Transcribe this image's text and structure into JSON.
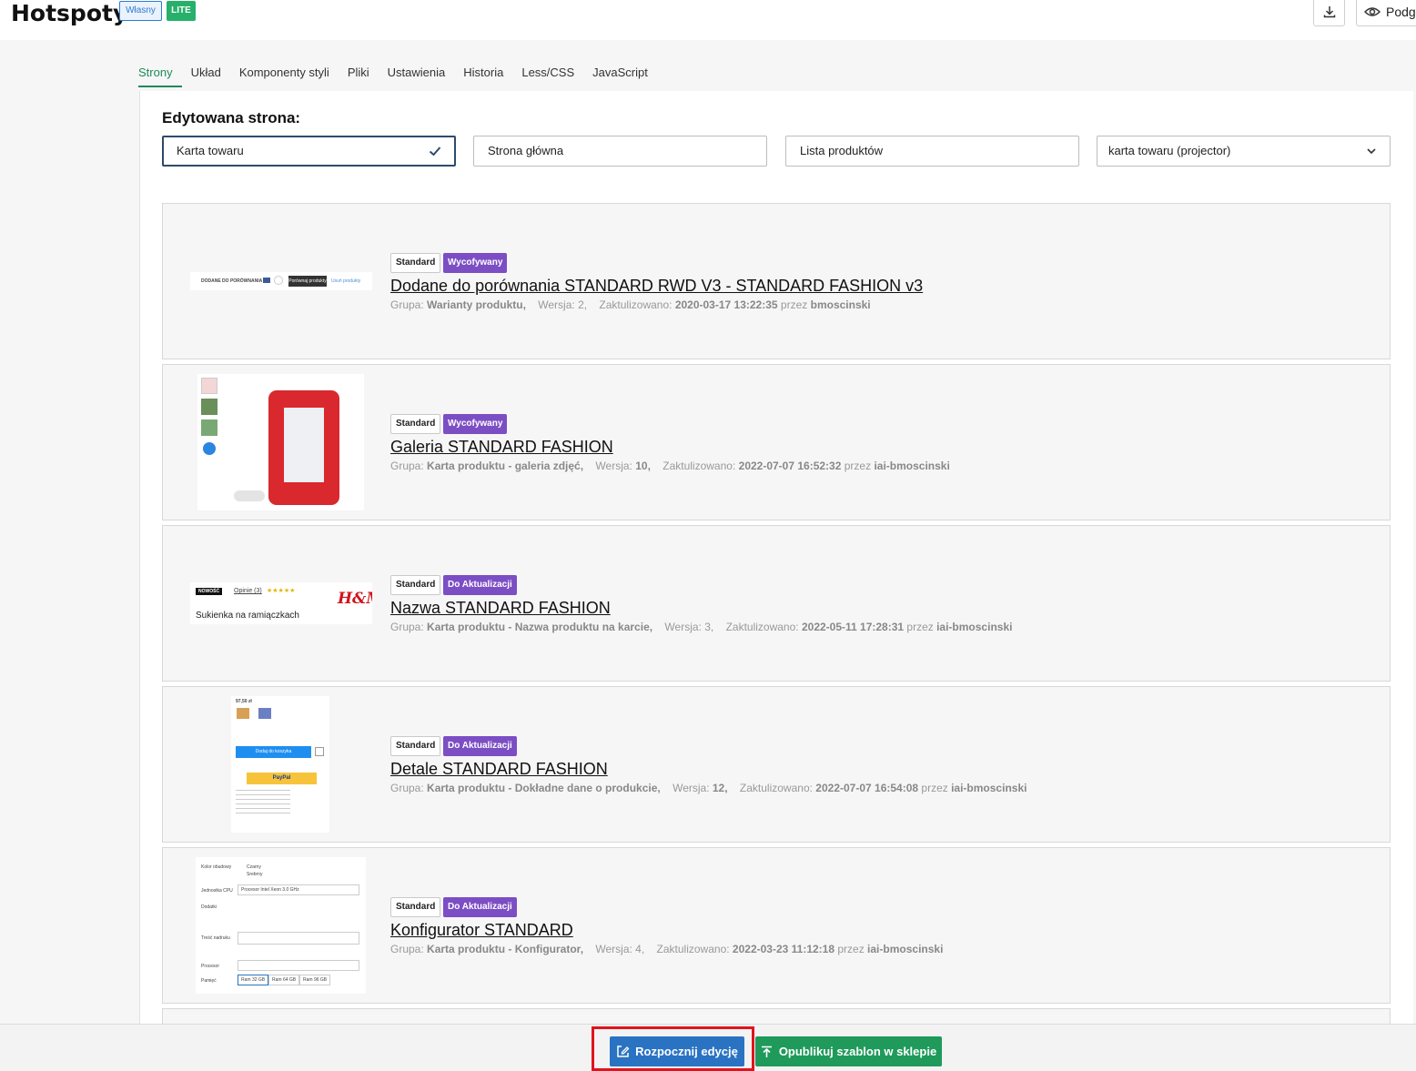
{
  "header": {
    "title": "Hotspoty",
    "badge_own": "Własny",
    "badge_lite": "LITE",
    "preview_label": "Podgląd"
  },
  "tabs": [
    {
      "label": "Strony",
      "active": true
    },
    {
      "label": "Układ"
    },
    {
      "label": "Komponenty styli"
    },
    {
      "label": "Pliki"
    },
    {
      "label": "Ustawienia"
    },
    {
      "label": "Historia"
    },
    {
      "label": "Less/CSS"
    },
    {
      "label": "JavaScript"
    }
  ],
  "editor": {
    "label": "Edytowana strona:",
    "pages": [
      {
        "label": "Karta towaru",
        "selected": true
      },
      {
        "label": "Strona główna"
      },
      {
        "label": "Lista produktów"
      },
      {
        "label": "karta towaru (projector)",
        "dropdown": true
      }
    ]
  },
  "components": [
    {
      "tags": [
        "Standard",
        "Wycofywany"
      ],
      "title": "Dodane do porównania STANDARD RWD V3 - STANDARD FASHION v3",
      "group_label": "Grupa:",
      "group": "Warianty produktu,",
      "version_label": "Wersja:",
      "version": "2,",
      "updated_label": "Zaktulizowano:",
      "updated": "2020-03-17 13:22:35",
      "by_label": "przez",
      "by": "bmoscinski",
      "thumb_text": [
        "DODANE DO PORÓWNANIA",
        "Porównaj produkty",
        "Usuń produkty"
      ]
    },
    {
      "tags": [
        "Standard",
        "Wycofywany"
      ],
      "title": "Galeria STANDARD FASHION",
      "group_label": "Grupa:",
      "group": "Karta produktu - galeria zdjęć,",
      "version_label": "Wersja:",
      "version": "10,",
      "updated_label": "Zaktulizowano:",
      "updated": "2022-07-07 16:52:32",
      "by_label": "przez",
      "by": "iai-bmoscinski"
    },
    {
      "tags": [
        "Standard",
        "Do Aktualizacji"
      ],
      "title": "Nazwa STANDARD FASHION",
      "group_label": "Grupa:",
      "group": "Karta produktu - Nazwa produktu na karcie,",
      "version_label": "Wersja:",
      "version": "3,",
      "updated_label": "Zaktulizowano:",
      "updated": "2022-05-11 17:28:31",
      "by_label": "przez",
      "by": "iai-bmoscinski",
      "thumb_text": [
        "NOWOŚĆ",
        "Opinie (3)",
        "★★★★★",
        "H&M",
        "Sukienka na ramiączkach"
      ]
    },
    {
      "tags": [
        "Standard",
        "Do Aktualizacji"
      ],
      "title": "Detale STANDARD FASHION",
      "group_label": "Grupa:",
      "group": "Karta produktu - Dokładne dane o produkcie,",
      "version_label": "Wersja:",
      "version": "12,",
      "updated_label": "Zaktulizowano:",
      "updated": "2022-07-07 16:54:08",
      "by_label": "przez",
      "by": "iai-bmoscinski",
      "thumb_text": [
        "97,50 zł",
        "Dodaj do koszyka",
        "PayPal"
      ]
    },
    {
      "tags": [
        "Standard",
        "Do Aktualizacji"
      ],
      "title": "Konfigurator STANDARD",
      "group_label": "Grupa:",
      "group": "Karta produktu - Konfigurator,",
      "version_label": "Wersja:",
      "version": "4,",
      "updated_label": "Zaktulizowano:",
      "updated": "2022-03-23 11:12:18",
      "by_label": "przez",
      "by": "iai-bmoscinski",
      "thumb_text": [
        "Kolor obudowy",
        "Czarny",
        "Srebrny",
        "Jednostka CPU",
        "Procesor Intel Xeon 3.0 GHz",
        "Dodatki",
        "Treść nadruku",
        "Procesor",
        "Pamięć",
        "Ram 32 GB",
        "Ram 64 GB",
        "Ram 96 GB"
      ]
    }
  ],
  "footer": {
    "edit_label": "Rozpocznij edycję",
    "publish_label": "Opublikuj szablon w sklepie"
  },
  "colors": {
    "accent_green": "#1e8a5a",
    "edit_blue": "#2a73c3",
    "publish_green": "#1f9a5b",
    "tag_purple": "#7c4ec4",
    "highlight_red": "#e0141c"
  }
}
